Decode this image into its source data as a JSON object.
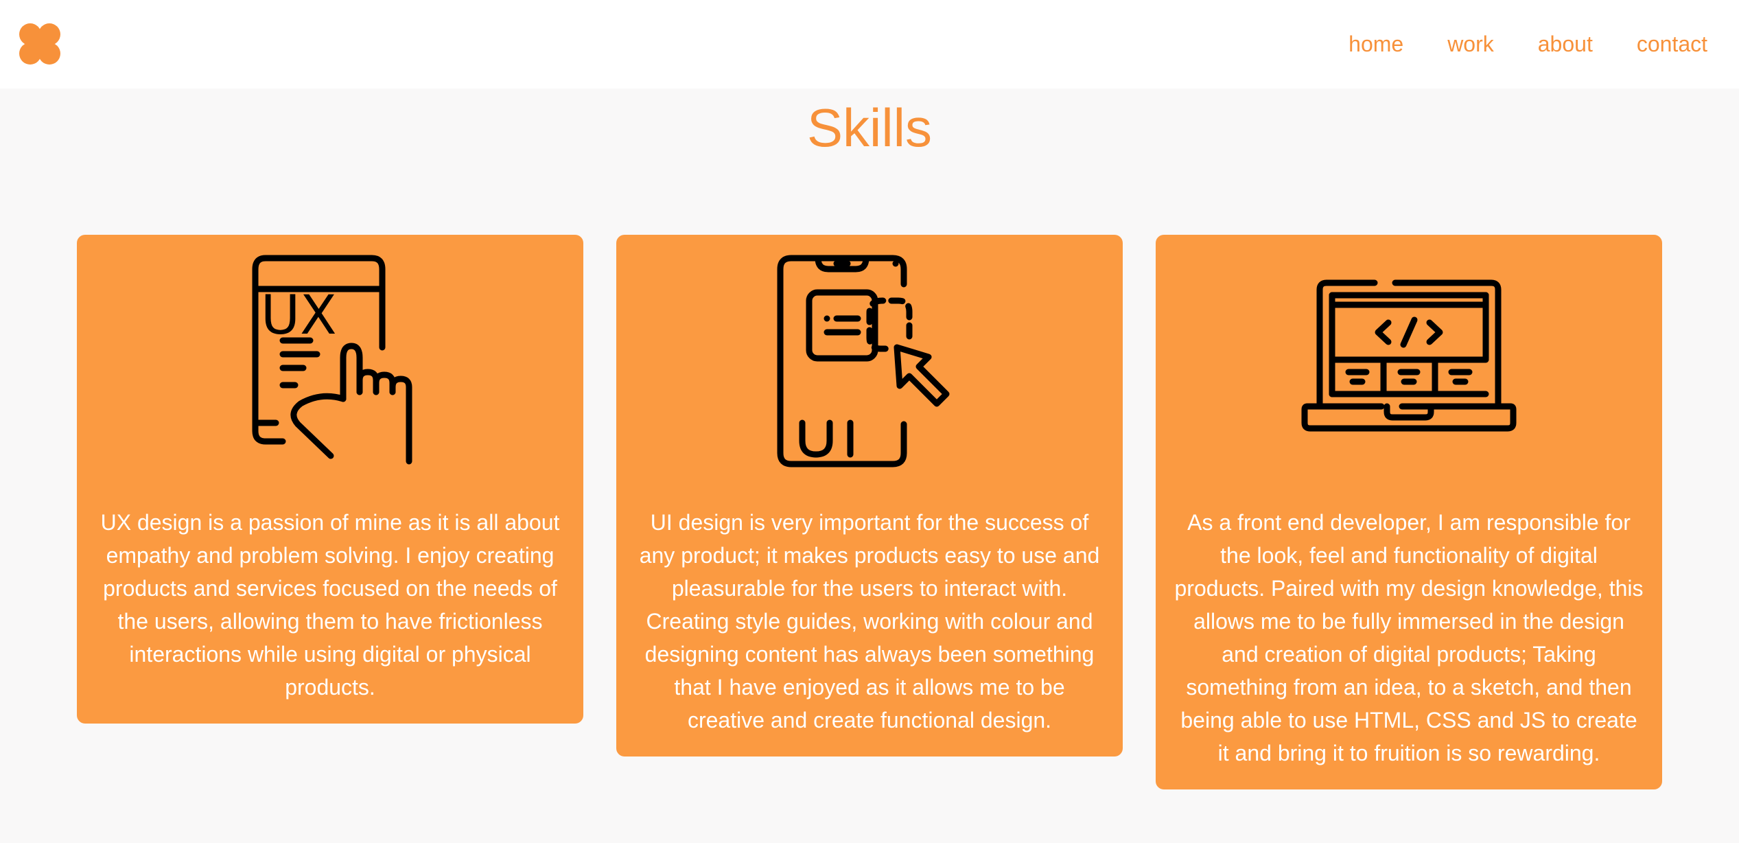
{
  "header": {
    "logo_icon": "four-petal-flower-icon",
    "nav": [
      {
        "label": "home"
      },
      {
        "label": "work"
      },
      {
        "label": "about"
      },
      {
        "label": "contact"
      }
    ]
  },
  "skills": {
    "title": "Skills",
    "cards": [
      {
        "icon": "ux-phone-tap-icon",
        "icon_text": "UX",
        "text": "UX design is a passion of mine as it is all about empathy and problem solving. I enjoy creating products and services focused on the needs of the users, allowing them to have frictionless interactions while using digital or physical products."
      },
      {
        "icon": "ui-phone-cursor-icon",
        "icon_text": "UI",
        "text": "UI design is very important for the success of any product; it makes products easy to use and pleasurable for the users to interact with. Creating style guides, working with colour and designing content has always been something that I have enjoyed as it allows me to be creative and create functional design."
      },
      {
        "icon": "laptop-code-icon",
        "text": "As a front end developer, I am responsible for the look, feel and functionality of digital products. Paired with my design knowledge, this allows me to be fully immersed in the design and creation of digital products; Taking something from an idea, to a sketch, and then being able to use HTML, CSS and JS to create it and bring it to fruition is so rewarding."
      }
    ]
  },
  "colors": {
    "accent": "#f7913a",
    "card_bg": "#fb9a41",
    "card_text": "#ffffff",
    "page_bg": "#f9f8f8",
    "header_bg": "#ffffff"
  }
}
